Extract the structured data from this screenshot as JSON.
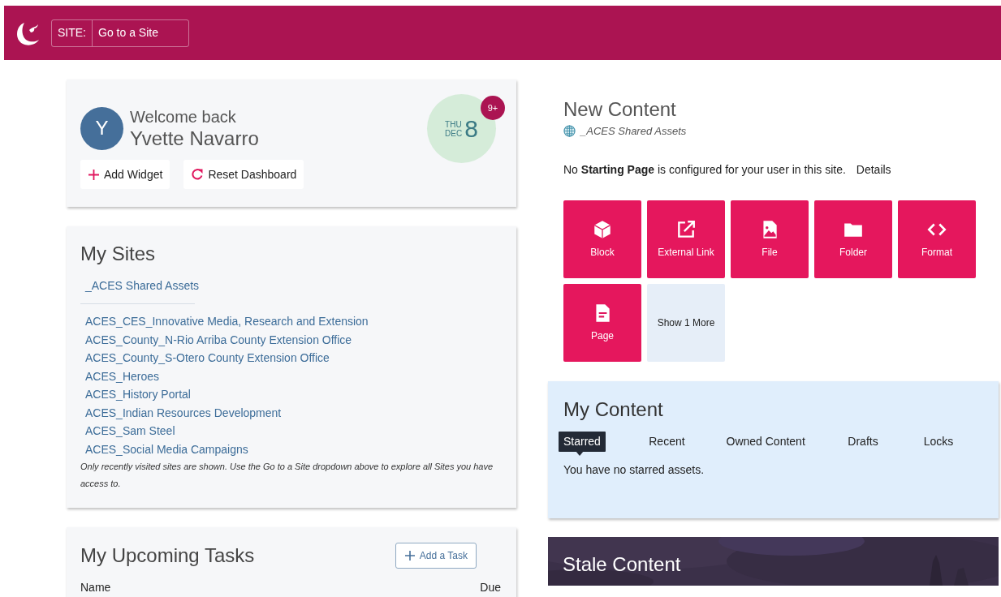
{
  "header": {
    "site_label": "SITE:",
    "site_value": "Go to a Site"
  },
  "welcome": {
    "avatar_letter": "Y",
    "greeting": "Welcome back",
    "name": "Yvette Navarro",
    "date": {
      "weekday": "THU",
      "month": "DEC",
      "day": "8"
    },
    "badge": "9+",
    "actions": [
      {
        "kind": "add",
        "label": "Add Widget"
      },
      {
        "kind": "reset",
        "label": "Reset Dashboard"
      }
    ]
  },
  "my_sites": {
    "title": "My Sites",
    "pinned": [
      "_ACES Shared Assets"
    ],
    "sites": [
      "ACES_CES_Innovative Media, Research and Extension",
      "ACES_County_N-Rio Arriba County Extension Office",
      "ACES_County_S-Otero County Extension Office",
      "ACES_Heroes",
      "ACES_History Portal",
      "ACES_Indian Resources Development",
      "ACES_Sam Steel",
      "ACES_Social Media Campaigns"
    ],
    "note": "Only recently visited sites are shown. Use the Go to a Site dropdown above to explore all Sites you have access to."
  },
  "tasks": {
    "title": "My Upcoming Tasks",
    "add_button": "Add a Task",
    "columns": [
      "Name",
      "Due"
    ]
  },
  "new_content": {
    "title": "New Content",
    "site": "_ACES Shared Assets",
    "message": "No **Starting Page** is configured for your user in this site.",
    "details_link": "Details",
    "tiles": [
      {
        "kind": "block",
        "label": "Block"
      },
      {
        "kind": "external_link",
        "label": "External Link"
      },
      {
        "kind": "file",
        "label": "File"
      },
      {
        "kind": "folder",
        "label": "Folder"
      },
      {
        "kind": "format",
        "label": "Format"
      },
      {
        "kind": "page",
        "label": "Page"
      }
    ],
    "more": "Show 1 More"
  },
  "my_content": {
    "title": "My Content",
    "tabs": [
      {
        "label": "Starred",
        "selected": true
      },
      {
        "label": "Recent",
        "selected": false
      },
      {
        "label": "Owned Content",
        "selected": false
      },
      {
        "label": "Drafts",
        "selected": false
      },
      {
        "label": "Locks",
        "selected": false
      }
    ],
    "empty_message": "You have no starred assets."
  },
  "stale_content": {
    "title": "Stale Content"
  }
}
